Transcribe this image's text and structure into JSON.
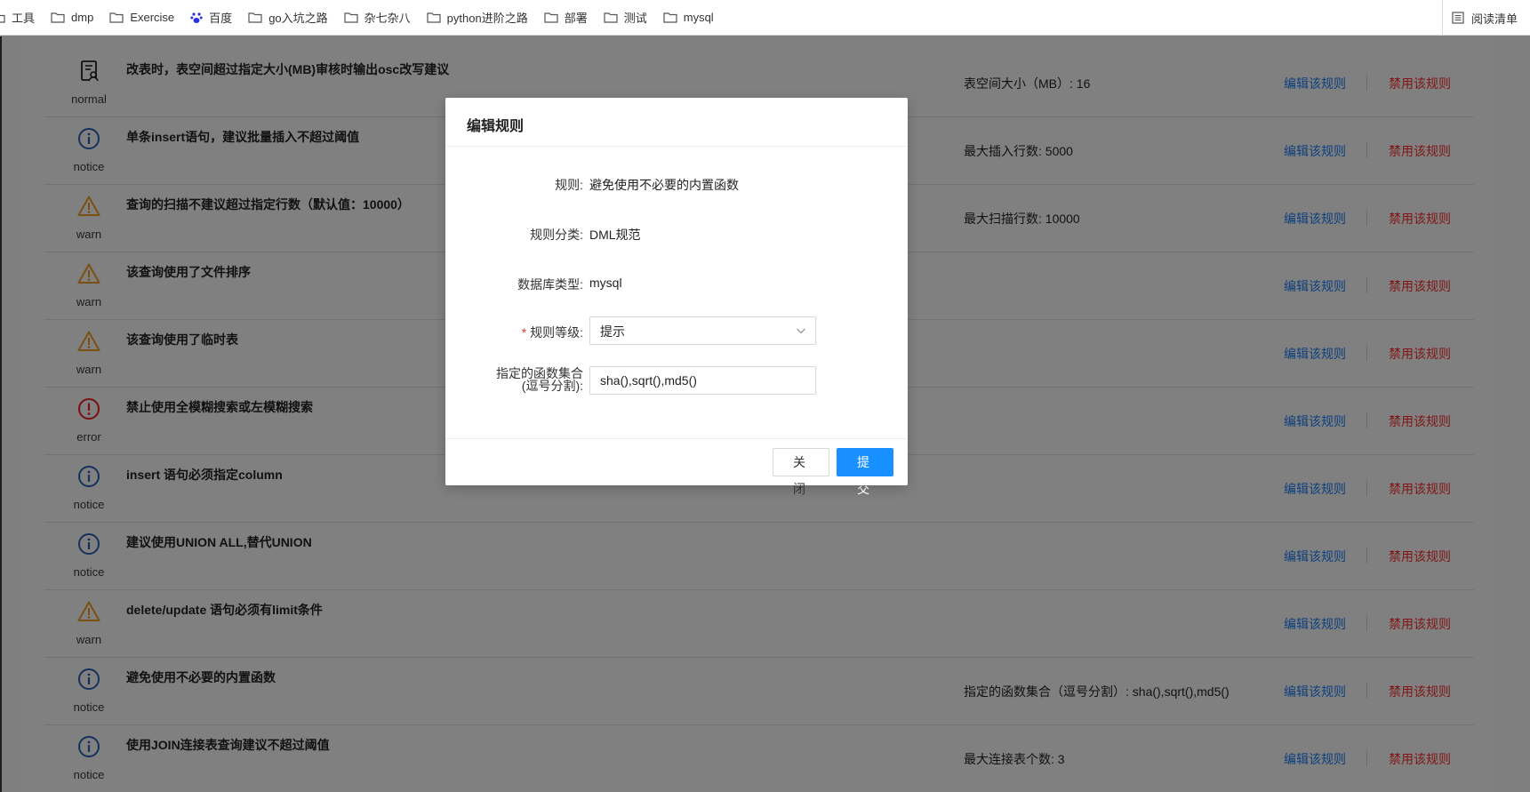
{
  "bookmarks": [
    {
      "label": "工具"
    },
    {
      "label": "dmp"
    },
    {
      "label": "Exercise"
    },
    {
      "label": "百度"
    },
    {
      "label": "go入坑之路"
    },
    {
      "label": "杂七杂八"
    },
    {
      "label": "python进阶之路"
    },
    {
      "label": "部署"
    },
    {
      "label": "测试"
    },
    {
      "label": "mysql"
    }
  ],
  "reading_list_label": "阅读清单",
  "rules": [
    {
      "level": "normal",
      "title": "改表时，表空间超过指定大小(MB)审核时输出osc改写建议",
      "param": "表空间大小（MB）: 16",
      "edit": "编辑该规则",
      "disable": "禁用该规则"
    },
    {
      "level": "notice",
      "title": "单条insert语句，建议批量插入不超过阈值",
      "param": "最大插入行数: 5000",
      "edit": "编辑该规则",
      "disable": "禁用该规则"
    },
    {
      "level": "warn",
      "title": "查询的扫描不建议超过指定行数（默认值：10000）",
      "param": "最大扫描行数: 10000",
      "edit": "编辑该规则",
      "disable": "禁用该规则"
    },
    {
      "level": "warn",
      "title": "该查询使用了文件排序",
      "param": "",
      "edit": "编辑该规则",
      "disable": "禁用该规则"
    },
    {
      "level": "warn",
      "title": "该查询使用了临时表",
      "param": "",
      "edit": "编辑该规则",
      "disable": "禁用该规则"
    },
    {
      "level": "error",
      "title": "禁止使用全模糊搜索或左模糊搜索",
      "param": "",
      "edit": "编辑该规则",
      "disable": "禁用该规则"
    },
    {
      "level": "notice",
      "title": "insert 语句必须指定column",
      "param": "",
      "edit": "编辑该规则",
      "disable": "禁用该规则"
    },
    {
      "level": "notice",
      "title": "建议使用UNION ALL,替代UNION",
      "param": "",
      "edit": "编辑该规则",
      "disable": "禁用该规则"
    },
    {
      "level": "warn",
      "title": "delete/update 语句必须有limit条件",
      "param": "",
      "edit": "编辑该规则",
      "disable": "禁用该规则"
    },
    {
      "level": "notice",
      "title": "避免使用不必要的内置函数",
      "param": "指定的函数集合（逗号分割）: sha(),sqrt(),md5()",
      "edit": "编辑该规则",
      "disable": "禁用该规则"
    },
    {
      "level": "notice",
      "title": "使用JOIN连接表查询建议不超过阈值",
      "param": "最大连接表个数: 3",
      "edit": "编辑该规则",
      "disable": "禁用该规则"
    }
  ],
  "modal": {
    "title": "编辑规则",
    "rule_label": "规则:",
    "rule_value": "避免使用不必要的内置函数",
    "category_label": "规则分类:",
    "category_value": "DML规范",
    "dbtype_label": "数据库类型:",
    "dbtype_value": "mysql",
    "level_required": "*",
    "level_label": "规则等级:",
    "level_value": "提示",
    "funcs_label_line1": "指定的函数集合",
    "funcs_label_line2": "(逗号分割):",
    "funcs_value": "sha(),sqrt(),md5()",
    "close_label": "关闭",
    "submit_label": "提交"
  },
  "colors": {
    "notice": "#14305e",
    "warn": "#7a5010",
    "error": "#7a0e0e",
    "link_edit": "#0d3f7e",
    "link_disable": "#7f1414",
    "primary": "#1890ff"
  }
}
